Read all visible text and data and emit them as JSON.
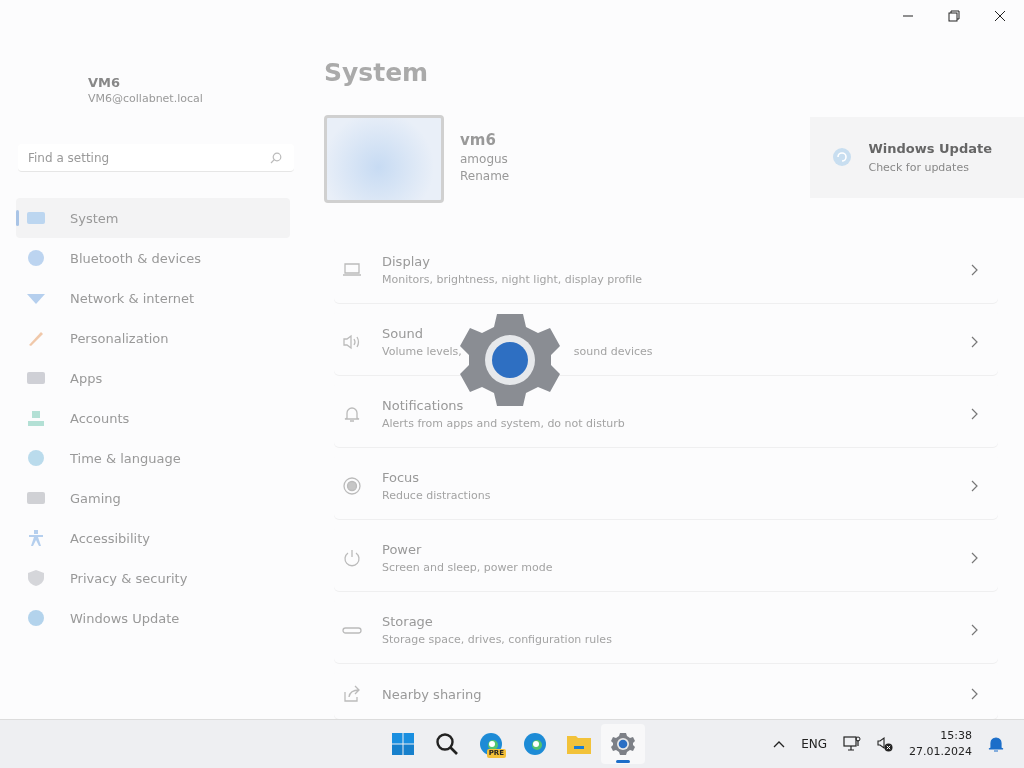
{
  "account": {
    "name": "VM6",
    "email": "VM6@collabnet.local"
  },
  "search": {
    "placeholder": "Find a setting"
  },
  "sidebar": {
    "items": [
      {
        "label": "System",
        "selected": true
      },
      {
        "label": "Bluetooth & devices",
        "selected": false
      },
      {
        "label": "Network & internet",
        "selected": false
      },
      {
        "label": "Personalization",
        "selected": false
      },
      {
        "label": "Apps",
        "selected": false
      },
      {
        "label": "Accounts",
        "selected": false
      },
      {
        "label": "Time & language",
        "selected": false
      },
      {
        "label": "Gaming",
        "selected": false
      },
      {
        "label": "Accessibility",
        "selected": false
      },
      {
        "label": "Privacy & security",
        "selected": false
      },
      {
        "label": "Windows Update",
        "selected": false
      }
    ]
  },
  "page": {
    "title": "System"
  },
  "device": {
    "name": "vm6",
    "model": "amogus",
    "rename": "Rename"
  },
  "update_card": {
    "title": "Windows Update",
    "subtitle": "Check for updates"
  },
  "settings": [
    {
      "title": "Display",
      "description": [
        "Monitors, brightness, night light, display profile"
      ]
    },
    {
      "title": "Sound",
      "description": [
        "Volume levels,",
        "sound devices"
      ]
    },
    {
      "title": "Notifications",
      "description": [
        "Alerts from apps and system, do not disturb"
      ]
    },
    {
      "title": "Focus",
      "description": [
        "Reduce distractions"
      ]
    },
    {
      "title": "Power",
      "description": [
        "Screen and sleep, power mode"
      ]
    },
    {
      "title": "Storage",
      "description": [
        "Storage space, drives, configuration rules"
      ]
    },
    {
      "title": "Nearby sharing"
    }
  ],
  "taskbar": {
    "apps": [
      {
        "kind": "start",
        "selected": false
      },
      {
        "kind": "search",
        "selected": false
      },
      {
        "kind": "edge-preview",
        "badge": "PRE",
        "selected": false
      },
      {
        "kind": "edge",
        "selected": false
      },
      {
        "kind": "explorer",
        "selected": false
      },
      {
        "kind": "settings",
        "selected": true
      }
    ],
    "language": "ENG",
    "time": "15:38",
    "date": "27.01.2024"
  }
}
